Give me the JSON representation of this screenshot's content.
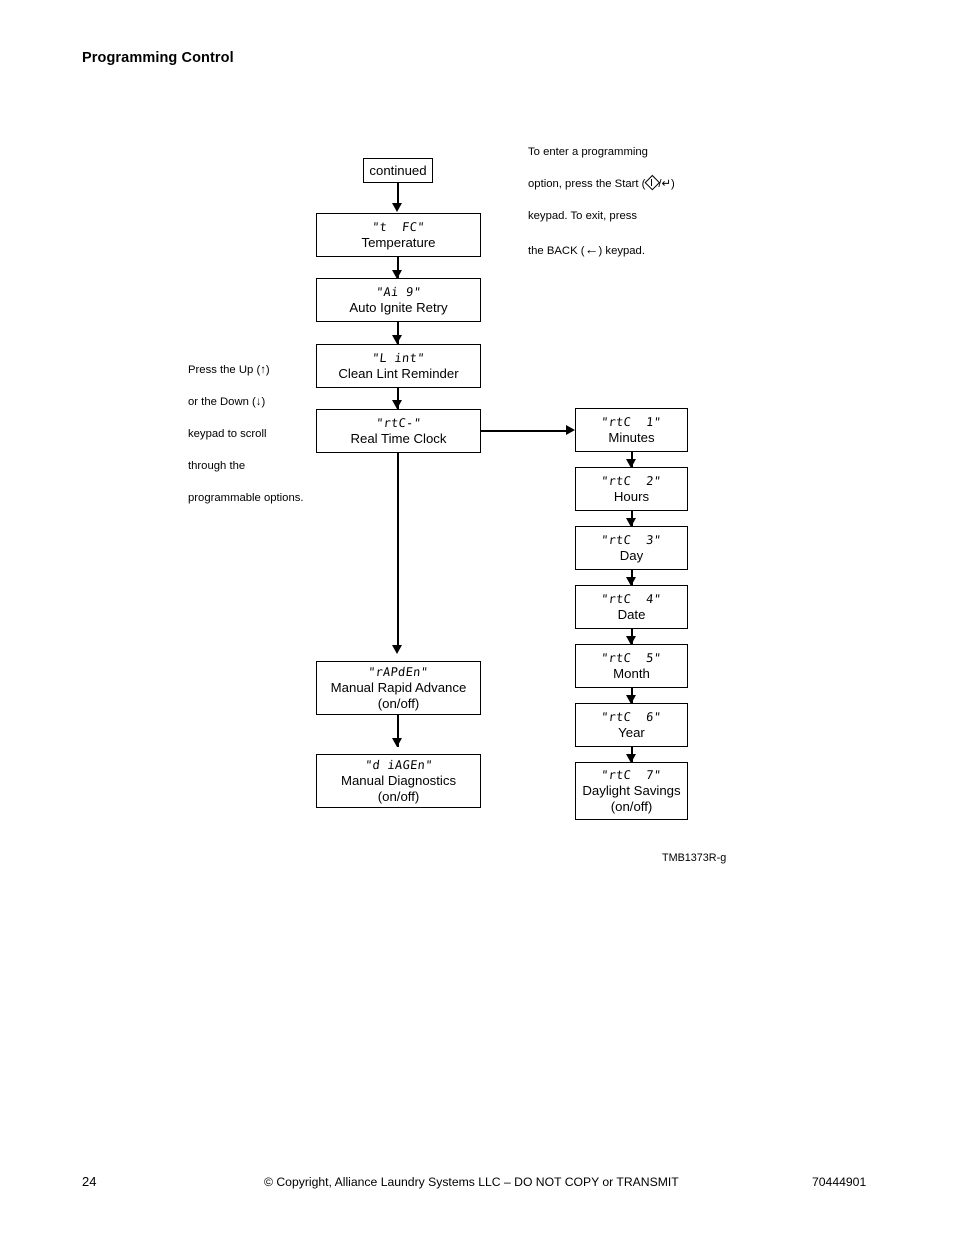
{
  "page": {
    "title": "Programming Control",
    "figure_ref": "TMB1373R-g"
  },
  "notes": {
    "scroll_note_line1": "Press the Up (↑)",
    "scroll_note_line2": "or the Down (↓)",
    "scroll_note_line3": "keypad to scroll",
    "scroll_note_line4": "through the",
    "scroll_note_line5": "programmable options.",
    "enter_note_line1": "To enter a programming",
    "enter_note_line2a": "option, press the Start (",
    "enter_note_line2b": "/↵)",
    "enter_note_line3": "keypad. To exit, press",
    "enter_note_line4a": "the BACK (",
    "enter_note_line4b": "←",
    "enter_note_line4c": ") keypad."
  },
  "flow": {
    "entry": {
      "label": "continued"
    },
    "main_column": [
      {
        "code": "\"t  FC\"",
        "label": "Temperature"
      },
      {
        "code": "\"Ai 9\"",
        "label": "Auto Ignite Retry"
      },
      {
        "code": "\"L int\"",
        "label": "Clean Lint Reminder"
      },
      {
        "code": "\"rtC-\"",
        "label": "Real Time Clock"
      },
      {
        "code": "\"rAPdEn\"",
        "label": "Manual Rapid Advance\n(on/off)"
      },
      {
        "code": "\"d iAGEn\"",
        "label": "Manual Diagnostics\n(on/off)"
      }
    ],
    "rtc_column": [
      {
        "code": "\"rtC  1\"",
        "label": "Minutes"
      },
      {
        "code": "\"rtC  2\"",
        "label": "Hours"
      },
      {
        "code": "\"rtC  3\"",
        "label": "Day"
      },
      {
        "code": "\"rtC  4\"",
        "label": "Date"
      },
      {
        "code": "\"rtC  5\"",
        "label": "Month"
      },
      {
        "code": "\"rtC  6\"",
        "label": "Year"
      },
      {
        "code": "\"rtC  7\"",
        "label": "Daylight Savings\n(on/off)"
      }
    ]
  },
  "footer": {
    "page_number": "24",
    "copyright": "© Copyright, Alliance Laundry Systems LLC – DO NOT COPY or TRANSMIT",
    "doc_number": "70444901"
  }
}
